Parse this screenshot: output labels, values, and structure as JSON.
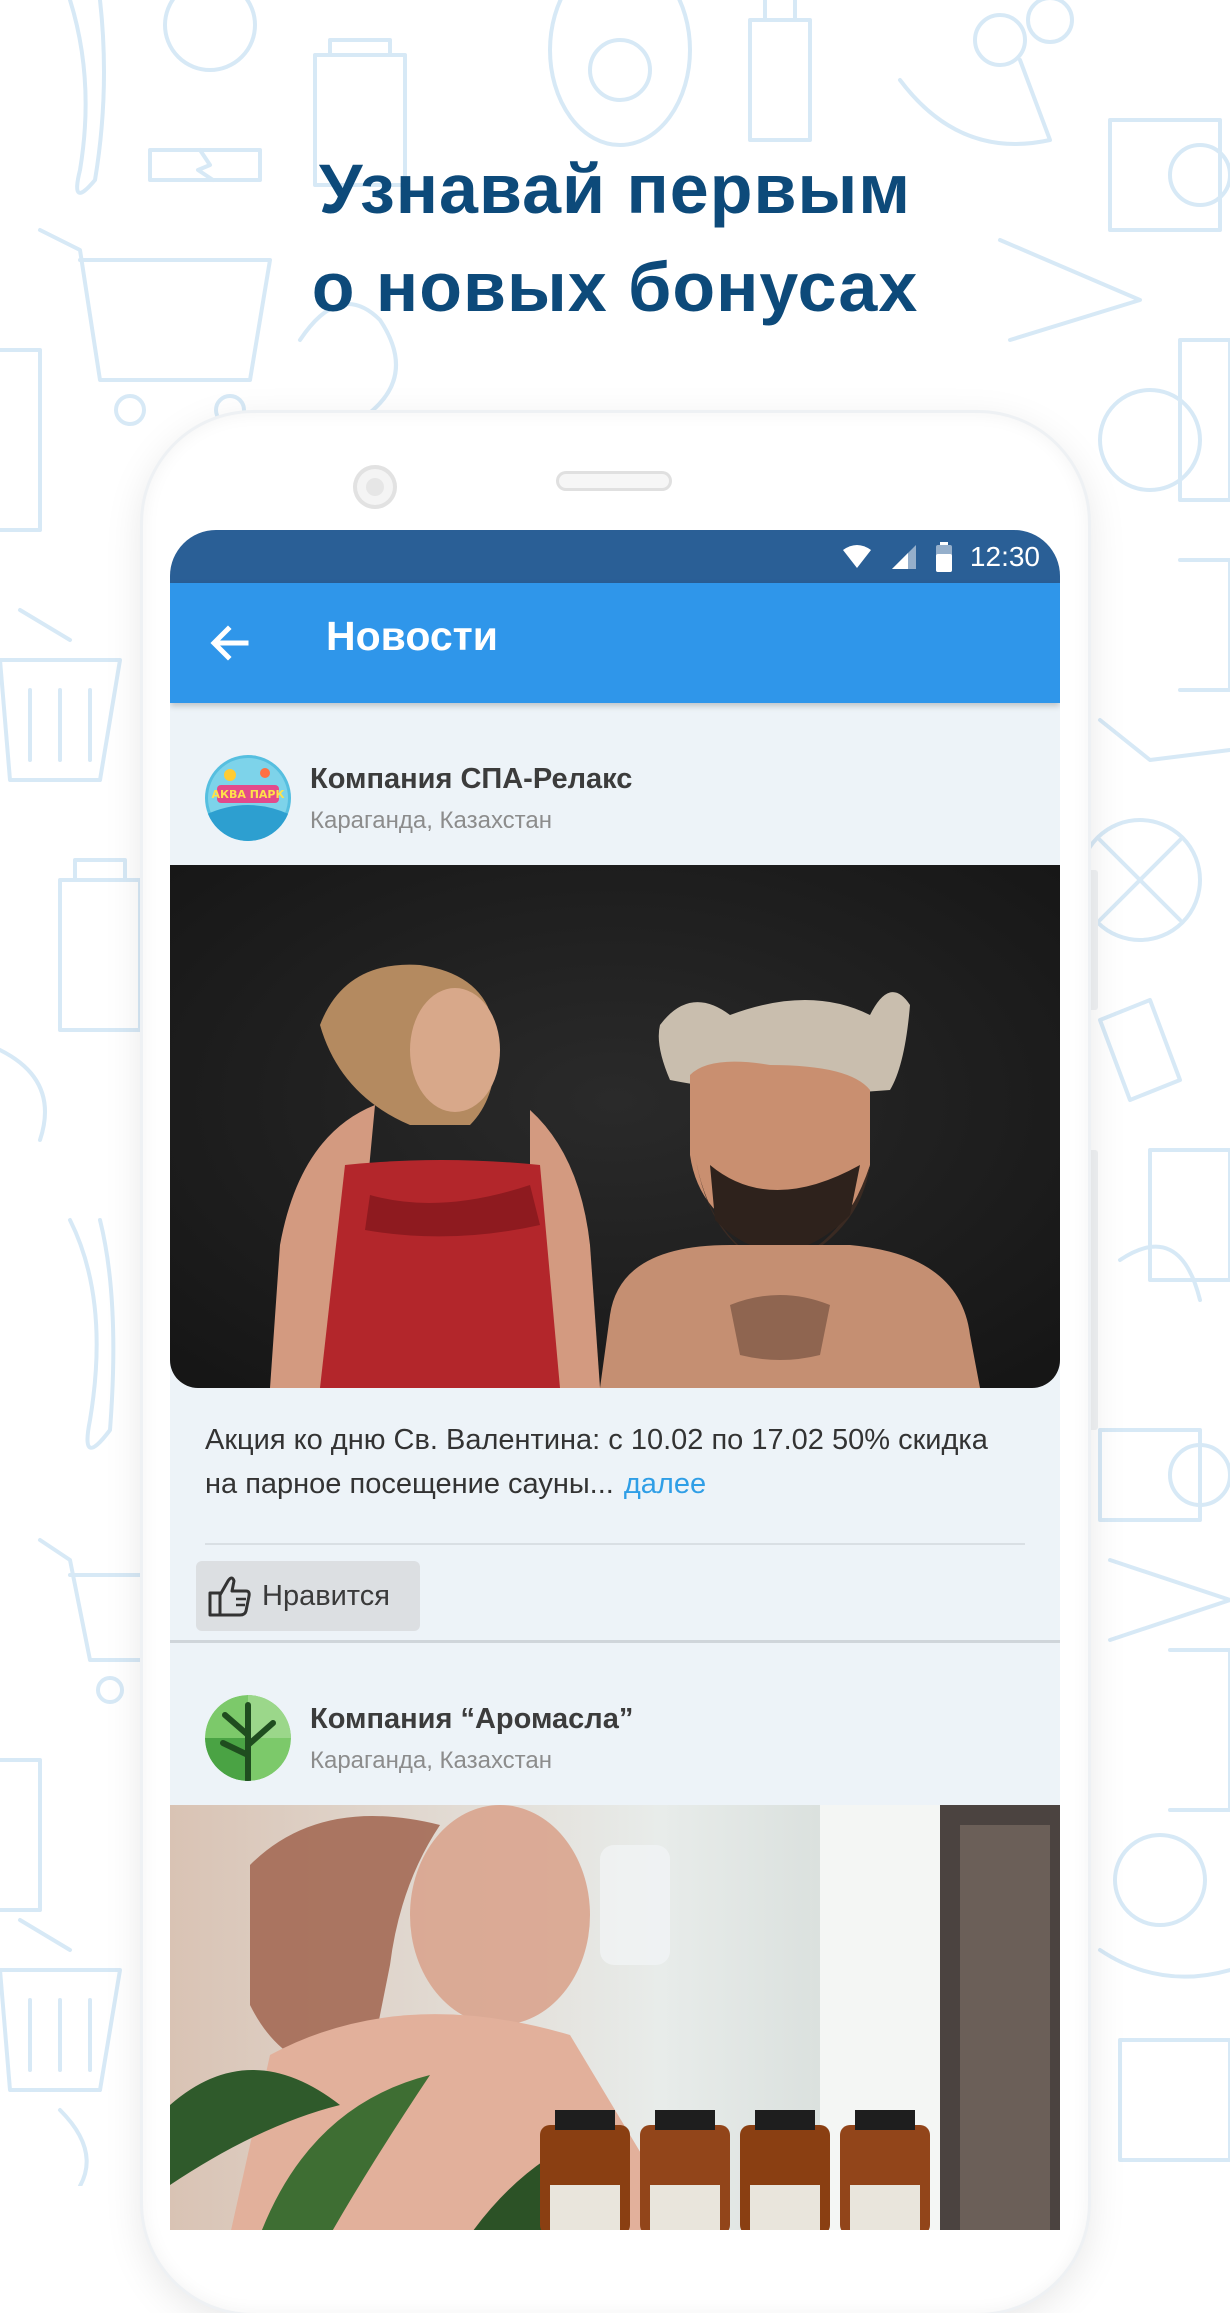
{
  "promo": {
    "headline_line1": "Узнавай первым",
    "headline_line2": "о новых бонусах"
  },
  "status_bar": {
    "time": "12:30",
    "icons": [
      "wifi-icon",
      "cellular-signal-icon",
      "battery-icon"
    ]
  },
  "app_bar": {
    "title": "Новости",
    "back_icon": "back-arrow-icon"
  },
  "posts": [
    {
      "company": "Компания СПА-Релакс",
      "location": "Караганда, Казахстан",
      "logo_text": "АКВА ПАРК",
      "text": "Акция ко дню Св. Валентина: с 10.02 по 17.02  50% скидка на парное посещение сауны...",
      "more_label": "далее",
      "like_label": "Нравится",
      "like_icon": "thumbs-up-icon"
    },
    {
      "company": "Компания “Аромасла”",
      "location": "Караганда, Казахстан"
    }
  ],
  "colors": {
    "headline": "#0d4a7a",
    "status_bar": "#2a5f96",
    "app_bar": "#2f96ea",
    "screen_bg": "#edf3f8",
    "link": "#2f9ee6",
    "pattern": "#d7e9f6"
  }
}
